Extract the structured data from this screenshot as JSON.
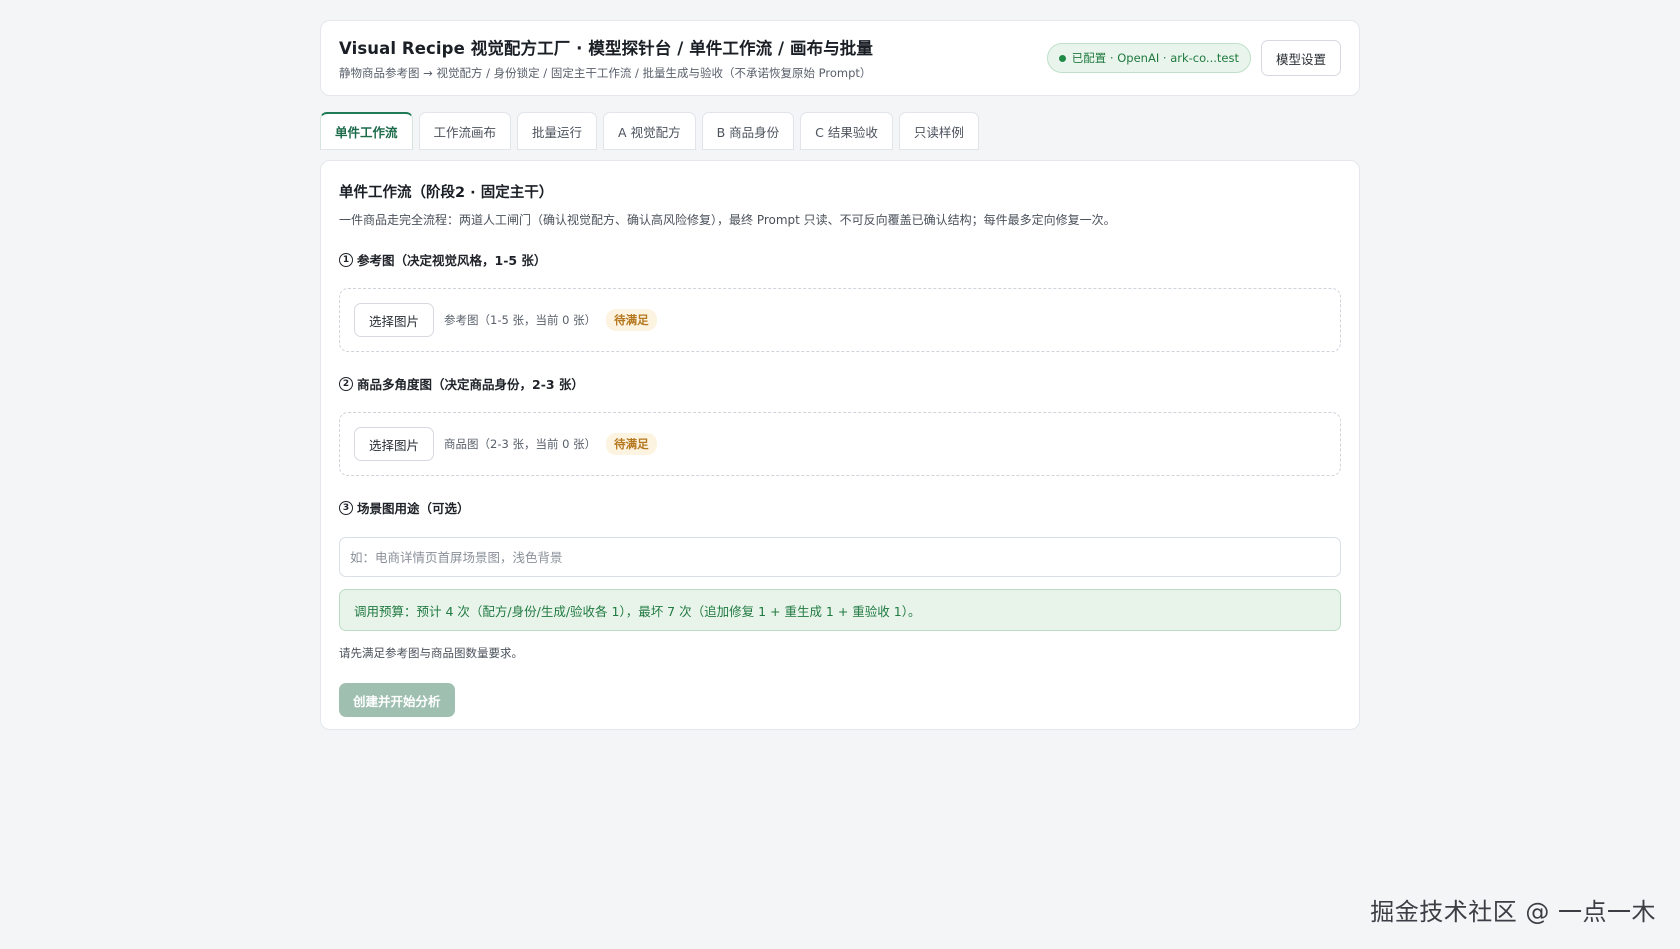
{
  "header": {
    "title": "Visual Recipe 视觉配方工厂 · 模型探针台 / 单件工作流 / 画布与批量",
    "subtitle": "静物商品参考图 → 视觉配方 / 身份锁定 / 固定主干工作流 / 批量生成与验收（不承诺恢复原始 Prompt）",
    "status": "已配置 · OpenAI · ark-co...test",
    "settings_button": "模型设置"
  },
  "tabs": [
    {
      "label": "单件工作流",
      "active": true
    },
    {
      "label": "工作流画布",
      "active": false
    },
    {
      "label": "批量运行",
      "active": false
    },
    {
      "label": "A 视觉配方",
      "active": false
    },
    {
      "label": "B 商品身份",
      "active": false
    },
    {
      "label": "C 结果验收",
      "active": false
    },
    {
      "label": "只读样例",
      "active": false
    }
  ],
  "main": {
    "title": "单件工作流（阶段2 · 固定主干）",
    "description": "一件商品走完全流程：两道人工闸门（确认视觉配方、确认高风险修复），最终 Prompt 只读、不可反向覆盖已确认结构；每件最多定向修复一次。",
    "step1": {
      "num": "1",
      "label": "参考图（决定视觉风格，1-5 张）",
      "button": "选择图片",
      "info": "参考图（1-5 张，当前 0 张）",
      "badge": "待满足"
    },
    "step2": {
      "num": "2",
      "label": "商品多角度图（决定商品身份，2-3 张）",
      "button": "选择图片",
      "info": "商品图（2-3 张，当前 0 张）",
      "badge": "待满足"
    },
    "step3": {
      "num": "3",
      "label": "场景图用途（可选）",
      "placeholder": "如：电商详情页首屏场景图，浅色背景"
    },
    "budget": "调用预算：预计 4 次（配方/身份/生成/验收各 1），最坏 7 次（追加修复 1 + 重生成 1 + 重验收 1）。",
    "hint": "请先满足参考图与商品图数量要求。",
    "submit_button": "创建并开始分析"
  },
  "watermark": "掘金技术社区 @ 一点一木"
}
